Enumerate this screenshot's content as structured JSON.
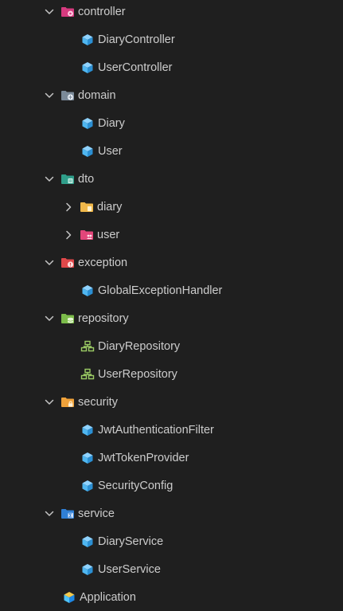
{
  "tree": [
    {
      "label": "controller",
      "type": "folder",
      "level": 1,
      "expanded": true,
      "icon": "folder-controller-icon",
      "color": "#d63a7f"
    },
    {
      "label": "DiaryController",
      "type": "class",
      "level": 2,
      "icon": "class-cube-icon"
    },
    {
      "label": "UserController",
      "type": "class",
      "level": 2,
      "icon": "class-cube-icon"
    },
    {
      "label": "domain",
      "type": "folder",
      "level": 1,
      "expanded": true,
      "icon": "folder-domain-icon",
      "color": "#7b8a99"
    },
    {
      "label": "Diary",
      "type": "class",
      "level": 2,
      "icon": "class-cube-icon"
    },
    {
      "label": "User",
      "type": "class",
      "level": 2,
      "icon": "class-cube-icon"
    },
    {
      "label": "dto",
      "type": "folder",
      "level": 1,
      "expanded": true,
      "icon": "folder-dto-icon",
      "color": "#2f9e8a"
    },
    {
      "label": "diary",
      "type": "folder",
      "level": 2,
      "expanded": false,
      "icon": "folder-diary-icon",
      "color": "#f0b84a"
    },
    {
      "label": "user",
      "type": "folder",
      "level": 2,
      "expanded": false,
      "icon": "folder-user-icon",
      "color": "#e2467a"
    },
    {
      "label": "exception",
      "type": "folder",
      "level": 1,
      "expanded": true,
      "icon": "folder-exception-icon",
      "color": "#e0484a"
    },
    {
      "label": "GlobalExceptionHandler",
      "type": "class",
      "level": 2,
      "icon": "class-cube-icon"
    },
    {
      "label": "repository",
      "type": "folder",
      "level": 1,
      "expanded": true,
      "icon": "folder-repository-icon",
      "color": "#7cbc4a"
    },
    {
      "label": "DiaryRepository",
      "type": "interface",
      "level": 2,
      "icon": "repository-interface-icon"
    },
    {
      "label": "UserRepository",
      "type": "interface",
      "level": 2,
      "icon": "repository-interface-icon"
    },
    {
      "label": "security",
      "type": "folder",
      "level": 1,
      "expanded": true,
      "icon": "folder-security-icon",
      "color": "#f0a23a"
    },
    {
      "label": "JwtAuthenticationFilter",
      "type": "class",
      "level": 2,
      "icon": "class-cube-icon"
    },
    {
      "label": "JwtTokenProvider",
      "type": "class",
      "level": 2,
      "icon": "class-cube-icon"
    },
    {
      "label": "SecurityConfig",
      "type": "class",
      "level": 2,
      "icon": "class-cube-icon"
    },
    {
      "label": "service",
      "type": "folder",
      "level": 1,
      "expanded": true,
      "icon": "folder-service-icon",
      "color": "#2f7fd6"
    },
    {
      "label": "DiaryService",
      "type": "class",
      "level": 2,
      "icon": "class-cube-icon"
    },
    {
      "label": "UserService",
      "type": "class",
      "level": 2,
      "icon": "class-cube-icon"
    },
    {
      "label": "Application",
      "type": "application",
      "level": 1,
      "icon": "application-cube-icon"
    }
  ]
}
